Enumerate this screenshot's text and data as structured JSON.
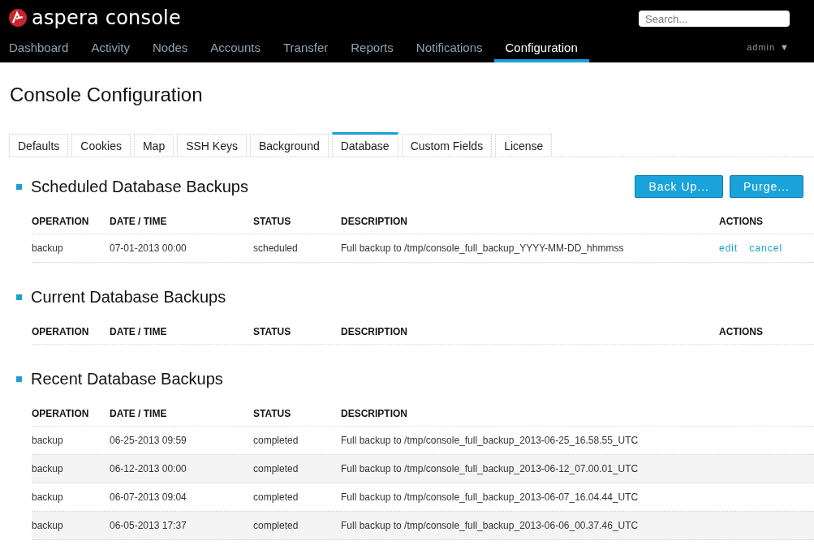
{
  "header": {
    "logo_text": "aspera console",
    "search": {
      "placeholder": "Search..."
    },
    "user": "admin",
    "user_caret": "▼"
  },
  "nav": [
    {
      "label": "Dashboard",
      "selected": false
    },
    {
      "label": "Activity",
      "selected": false
    },
    {
      "label": "Nodes",
      "selected": false
    },
    {
      "label": "Accounts",
      "selected": false
    },
    {
      "label": "Transfer",
      "selected": false
    },
    {
      "label": "Reports",
      "selected": false
    },
    {
      "label": "Notifications",
      "selected": false
    },
    {
      "label": "Configuration",
      "selected": true
    }
  ],
  "page_title": "Console Configuration",
  "tabs": [
    {
      "label": "Defaults",
      "selected": false
    },
    {
      "label": "Cookies",
      "selected": false
    },
    {
      "label": "Map",
      "selected": false
    },
    {
      "label": "SSH Keys",
      "selected": false
    },
    {
      "label": "Background",
      "selected": false
    },
    {
      "label": "Database",
      "selected": true
    },
    {
      "label": "Custom Fields",
      "selected": false
    },
    {
      "label": "License",
      "selected": false
    }
  ],
  "sections": [
    {
      "title": "Scheduled Database Backups",
      "buttons": [
        "Back Up...",
        "Purge..."
      ],
      "columns": [
        "OPERATION",
        "DATE / TIME",
        "STATUS",
        "DESCRIPTION",
        "ACTIONS"
      ],
      "rows": [
        {
          "cells": [
            "backup",
            "07-01-2013 00:00",
            "scheduled",
            "Full backup to /tmp/console_full_backup_YYYY-MM-DD_hhmmss"
          ],
          "actions": [
            "edit",
            "cancel"
          ]
        }
      ]
    },
    {
      "title": "Current Database Backups",
      "columns": [
        "OPERATION",
        "DATE / TIME",
        "STATUS",
        "DESCRIPTION",
        "ACTIONS"
      ]
    },
    {
      "title": "Recent Database Backups",
      "columns": [
        "OPERATION",
        "DATE / TIME",
        "STATUS",
        "DESCRIPTION"
      ],
      "rows": [
        {
          "cells": [
            "backup",
            "06-25-2013 09:59",
            "completed",
            "Full backup to /tmp/console_full_backup_2013-06-25_16.58.55_UTC"
          ]
        },
        {
          "cells": [
            "backup",
            "06-12-2013 00:00",
            "completed",
            "Full backup to /tmp/console_full_backup_2013-06-12_07.00.01_UTC"
          ]
        },
        {
          "cells": [
            "backup",
            "06-07-2013 09:04",
            "completed",
            "Full backup to /tmp/console_full_backup_2013-06-07_16.04.44_UTC"
          ]
        },
        {
          "cells": [
            "backup",
            "06-05-2013 17:37",
            "completed",
            "Full backup to /tmp/console_full_backup_2013-06-06_00.37.46_UTC"
          ]
        }
      ]
    }
  ]
}
